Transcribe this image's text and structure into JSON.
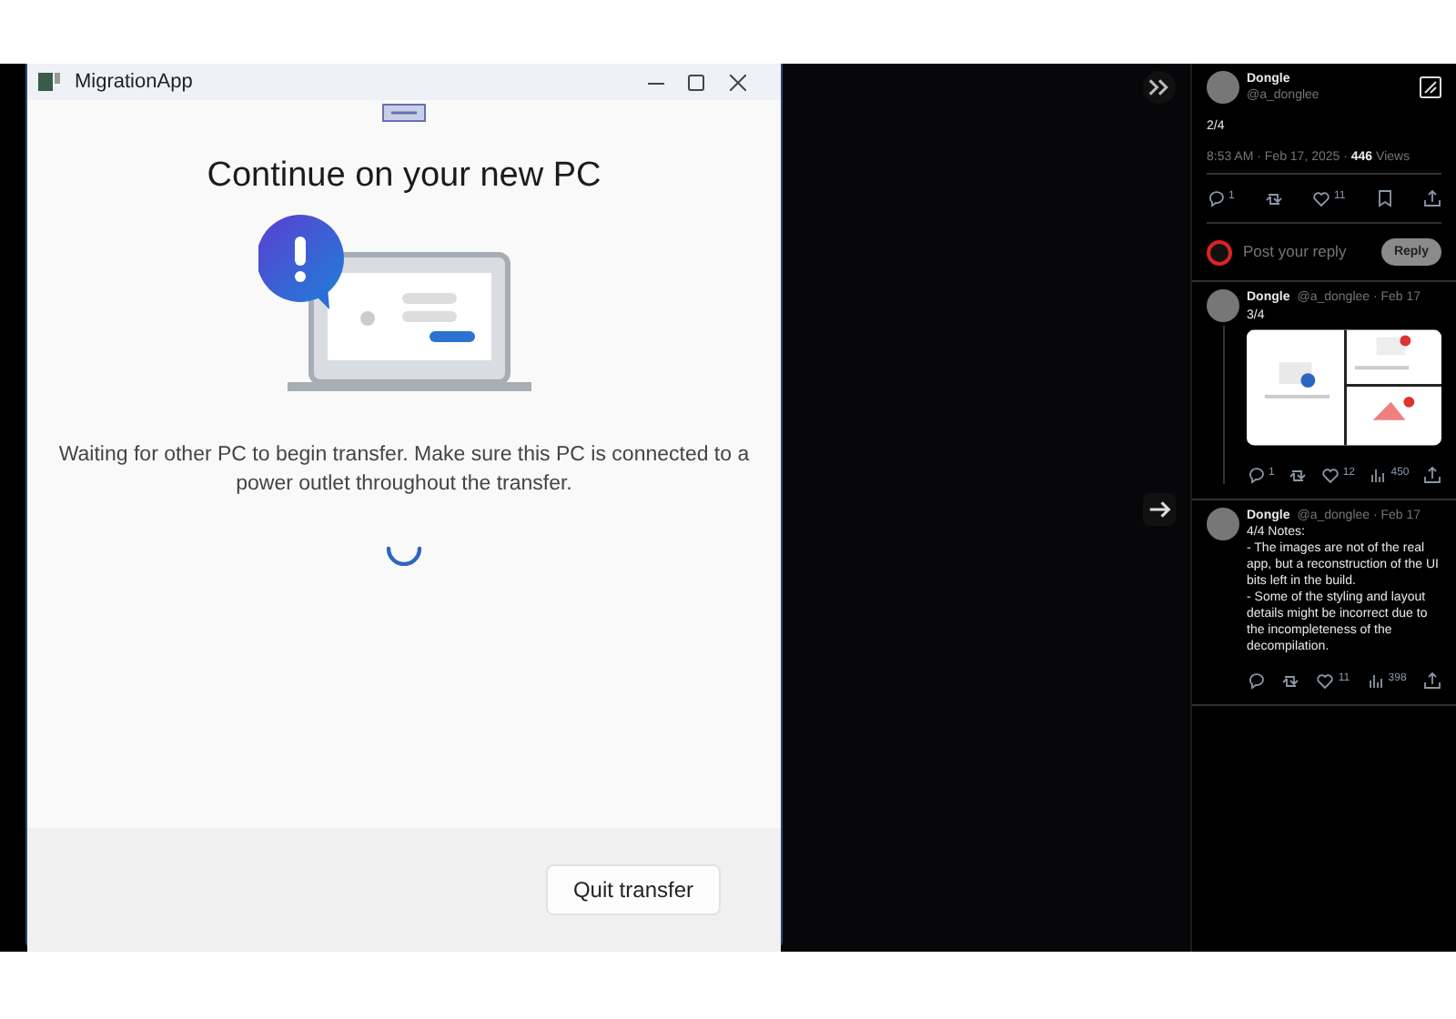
{
  "window": {
    "title": "MigrationApp",
    "heading": "Continue on your new PC",
    "message": "Waiting for other PC to begin transfer. Make sure this PC is connected to a power outlet throughout the transfer.",
    "button": "Quit transfer"
  },
  "thread": {
    "main": {
      "author": "Dongle",
      "handle": "@a_donglee",
      "text": "2/4",
      "meta": "8:53 AM · Feb 17, 2025 · **446** Views",
      "replies": "1",
      "likes": "11"
    },
    "reply_box": {
      "placeholder": "Post your reply",
      "button": "Reply"
    },
    "replies": [
      {
        "author": "Dongle",
        "handle": "@a_donglee · Feb 17",
        "text": "3/4",
        "attachment": true,
        "replies": "1",
        "likes": "12",
        "views": "450"
      },
      {
        "author": "Dongle",
        "handle": "@a_donglee · Feb 17",
        "text": "4/4 Notes:\n- The images are not of the real app, but a reconstruction of the UI bits left in the build.\n- Some of the styling and layout details might be incorrect due to the incompleteness of the decompilation.",
        "attachment": false,
        "views": "398",
        "likes": "11"
      }
    ]
  }
}
